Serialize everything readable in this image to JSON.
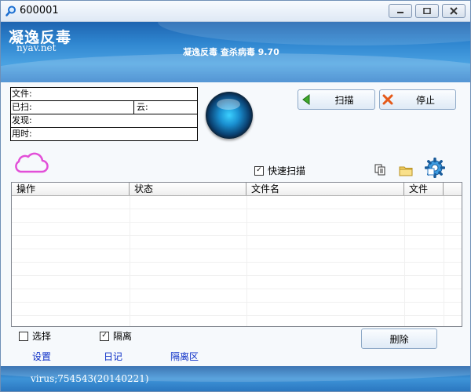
{
  "window": {
    "title": "600001"
  },
  "banner": {
    "brand": "凝逸反毒",
    "url": "nyav.net",
    "version": "凝逸反毒  查杀病毒  9.70"
  },
  "info": {
    "file_label": "文件:",
    "scanned_label": "已扫:",
    "cloud_label": "云:",
    "found_label": "发现:",
    "time_label": "用时:"
  },
  "buttons": {
    "scan": "扫描",
    "stop": "停止",
    "delete": "删除"
  },
  "options": {
    "quick_scan": "快速扫描",
    "select": "选择",
    "quarantine": "隔离"
  },
  "list": {
    "columns": [
      "操作",
      "状态",
      "文件名",
      "文件"
    ]
  },
  "links": {
    "settings": "设置",
    "log": "日记",
    "quarantine_zone": "隔离区"
  },
  "status": {
    "text": "virus;754543(20140221)"
  },
  "colors": {
    "accent": "#2f86d0",
    "link": "#0b2ec7",
    "cloud": "#e24fd8"
  }
}
